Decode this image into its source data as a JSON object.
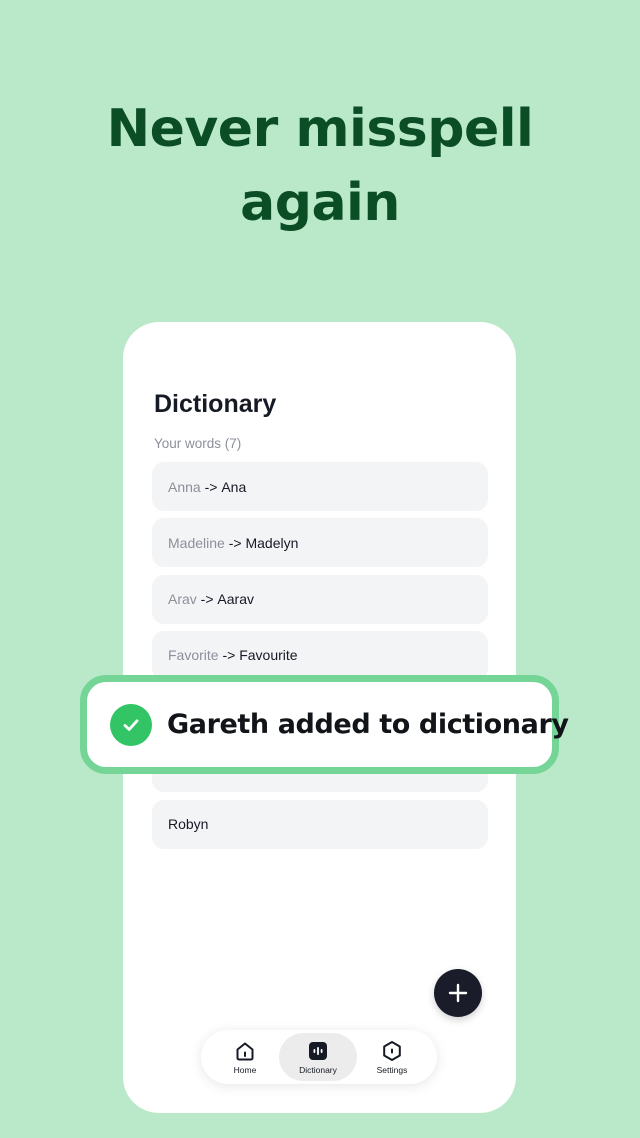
{
  "marketing": {
    "headline_line1": "Never misspell",
    "headline_line2": "again"
  },
  "screen": {
    "title": "Dictionary",
    "section_label": "Your words (7)",
    "words": [
      {
        "original": "Anna",
        "arrow": " -> ",
        "replacement": "Ana"
      },
      {
        "original": "Madeline",
        "arrow": " -> ",
        "replacement": "Madelyn"
      },
      {
        "original": "Arav",
        "arrow": " -> ",
        "replacement": "Aarav"
      },
      {
        "original": "Favorite",
        "arrow": " -> ",
        "replacement": "Favourite"
      },
      {
        "original": "",
        "arrow": "",
        "replacement": ""
      },
      {
        "original": "",
        "arrow": "",
        "replacement": ""
      },
      {
        "original": "Robyn",
        "arrow": "",
        "replacement": ""
      }
    ]
  },
  "toast": {
    "message": "Gareth added to dictionary",
    "icon": "check-icon",
    "color": "#33c466",
    "border_color": "#74d597"
  },
  "fab": {
    "icon": "plus-icon"
  },
  "nav": {
    "active": "dictionary",
    "items": [
      {
        "id": "home",
        "label": "Home",
        "icon": "home-icon"
      },
      {
        "id": "dictionary",
        "label": "Dictionary",
        "icon": "dictionary-icon"
      },
      {
        "id": "settings",
        "label": "Settings",
        "icon": "settings-icon"
      }
    ]
  },
  "colors": {
    "background": "#b9e9c8",
    "headline": "#0b4d25",
    "fab": "#1a1d29"
  }
}
